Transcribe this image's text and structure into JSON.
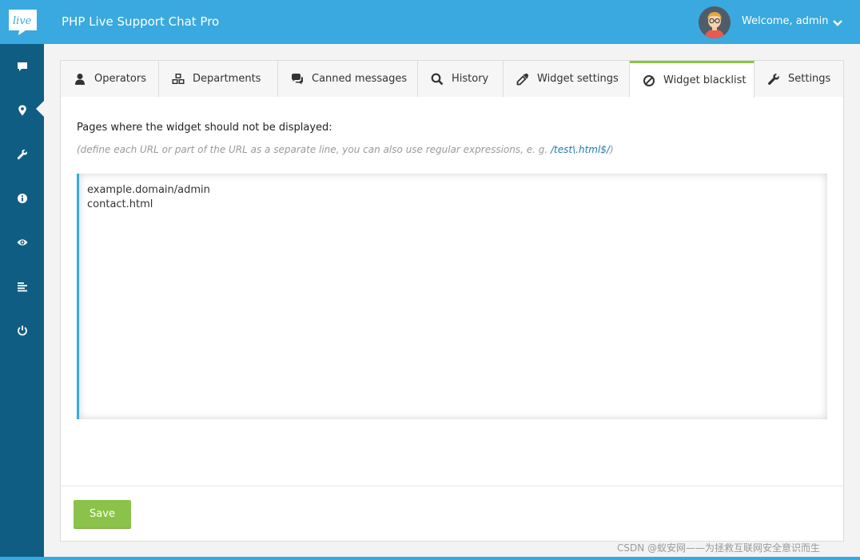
{
  "header": {
    "app_title": "PHP Live Support Chat Pro",
    "logo_text": "live",
    "welcome": "Welcome, admin"
  },
  "sidebar": {
    "items": [
      {
        "icon": "chat-icon"
      },
      {
        "icon": "map-pin-icon"
      },
      {
        "icon": "wrench-icon",
        "active": true
      },
      {
        "icon": "info-icon"
      },
      {
        "icon": "eye-icon"
      },
      {
        "icon": "list-icon"
      },
      {
        "icon": "power-icon"
      }
    ]
  },
  "tabs": [
    {
      "label": "Operators",
      "icon": "user-icon"
    },
    {
      "label": "Departments",
      "icon": "cubes-icon"
    },
    {
      "label": "Canned messages",
      "icon": "comments-icon"
    },
    {
      "label": "History",
      "icon": "search-icon"
    },
    {
      "label": "Widget settings",
      "icon": "eyedropper-icon"
    },
    {
      "label": "Widget blacklist",
      "icon": "ban-icon",
      "active": true
    },
    {
      "label": "Settings",
      "icon": "wrench-icon"
    }
  ],
  "content": {
    "label": "Pages where the widget should not be displayed:",
    "hint_prefix": "(define each URL or part of the URL as a separate line, you can also use regular expressions, e. g. ",
    "hint_regex": "/test\\.html$/",
    "hint_suffix": ")",
    "textarea_value": "example.domain/admin\ncontact.html"
  },
  "footer": {
    "save_label": "Save"
  },
  "watermark": "CSDN @蚁安网——为拯救互联网安全意识而生",
  "colors": {
    "header": "#39a9df",
    "sidebar": "#105d83",
    "accent_green": "#8bc34a",
    "textarea_border": "#39a9df"
  }
}
